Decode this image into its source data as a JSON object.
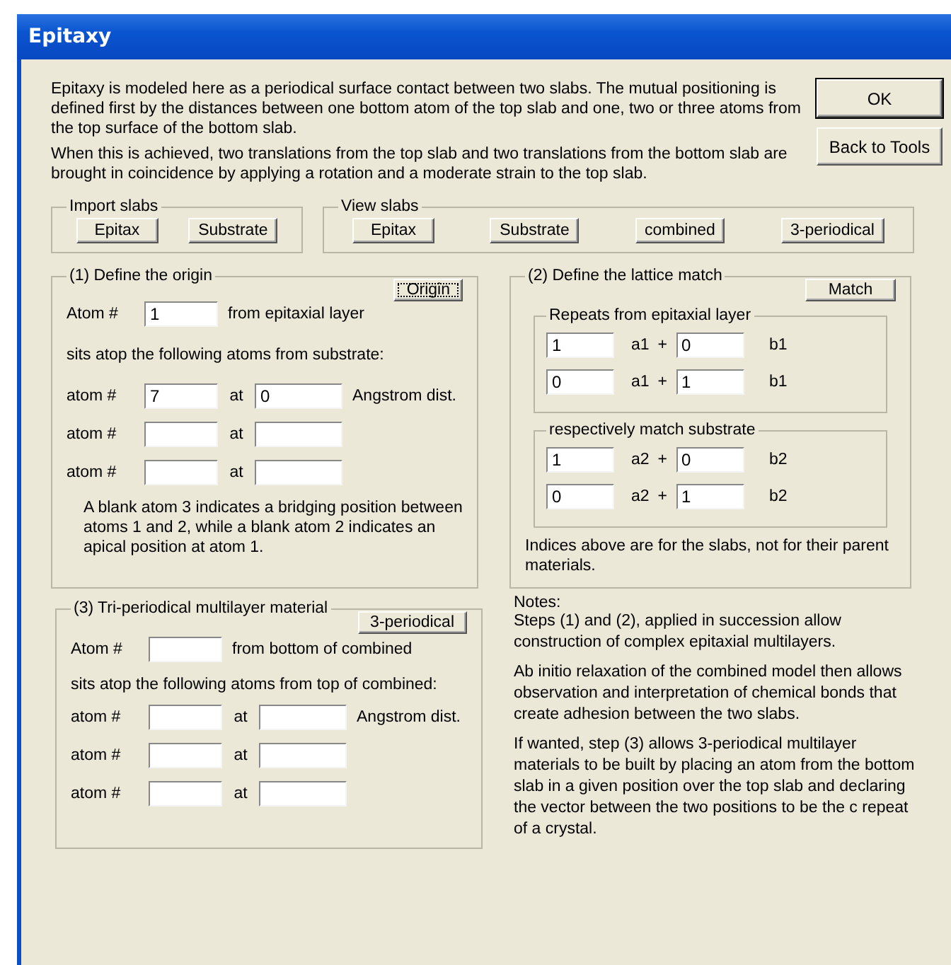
{
  "window": {
    "title": "Epitaxy"
  },
  "intro": [
    "Epitaxy is modeled here as a periodical surface contact between two slabs. The mutual positioning is defined first by the distances between one bottom atom of the top slab and one, two or three atoms from the top surface of the bottom slab.",
    "When this is achieved, two translations from the top slab and two translations from the bottom slab are brought in coincidence by applying a rotation and a moderate strain to the top slab."
  ],
  "buttons": [
    {
      "label": "OK",
      "default": true
    },
    {
      "label": "Back to Tools",
      "default": false
    }
  ],
  "import_slabs": {
    "title": "Import slabs",
    "buttons": [
      "Epitax",
      "Substrate"
    ]
  },
  "view_slabs": {
    "title": "View slabs",
    "buttons": [
      "Epitax",
      "Substrate",
      "combined",
      "3-periodical"
    ]
  },
  "origin": {
    "title": "(1) Define the origin",
    "button": {
      "label": "Origin",
      "focused": true
    },
    "atom_label": "Atom #",
    "atom_value": "1",
    "atom_suffix": "from epitaxial layer",
    "sits_text": "sits atop the following atoms from substrate:",
    "rows": [
      {
        "label": "atom #",
        "atom": "7",
        "at": "at",
        "distance": "0",
        "unit": "Angstrom dist."
      },
      {
        "label": "atom #",
        "at": "at"
      },
      {
        "label": "atom #",
        "at": "at"
      }
    ],
    "note": "A blank atom 3 indicates a bridging position between atoms 1 and 2, while a blank atom 2 indicates an apical position at atom 1."
  },
  "lattice": {
    "title": "(2) Define the lattice match",
    "button": "Match",
    "groups": [
      {
        "title": "Repeats from epitaxial layer",
        "rows": [
          {
            "c1": "1",
            "basis1": "a1",
            "plus": "+",
            "c2": "0",
            "basis2": "b1"
          },
          {
            "c1": "0",
            "basis1": "a1",
            "plus": "+",
            "c2": "1",
            "basis2": "b1"
          }
        ]
      },
      {
        "title": "respectively match substrate",
        "rows": [
          {
            "c1": "1",
            "basis1": "a2",
            "plus": "+",
            "c2": "0",
            "basis2": "b2"
          },
          {
            "c1": "0",
            "basis1": "a2",
            "plus": "+",
            "c2": "1",
            "basis2": "b2"
          }
        ]
      }
    ],
    "note": "Indices above are for the slabs, not for their parent materials."
  },
  "multilayer": {
    "title": "(3) Tri-periodical multilayer material",
    "button": {
      "label": "3-periodical",
      "focused": false
    },
    "atom_label": "Atom #",
    "atom_suffix": "from bottom of combined",
    "sits_text": "sits atop the following atoms from top of combined:",
    "rows": [
      {
        "label": "atom #",
        "at": "at",
        "unit": "Angstrom dist."
      },
      {
        "label": "atom #",
        "at": "at"
      },
      {
        "label": "atom #",
        "at": "at"
      }
    ]
  },
  "notes": {
    "title": "Notes:",
    "paragraphs": [
      "Steps (1) and (2), applied in succession allow construction of complex epitaxial multilayers.",
      "Ab initio relaxation of the combined model then allows observation and interpretation of chemical bonds that create adhesion between the two slabs.",
      "If wanted, step (3) allows 3-periodical multilayer materials to be built by placing an atom from the bottom slab in a given position over the top slab and declaring the vector between the two positions to be the c repeat of a crystal."
    ]
  }
}
